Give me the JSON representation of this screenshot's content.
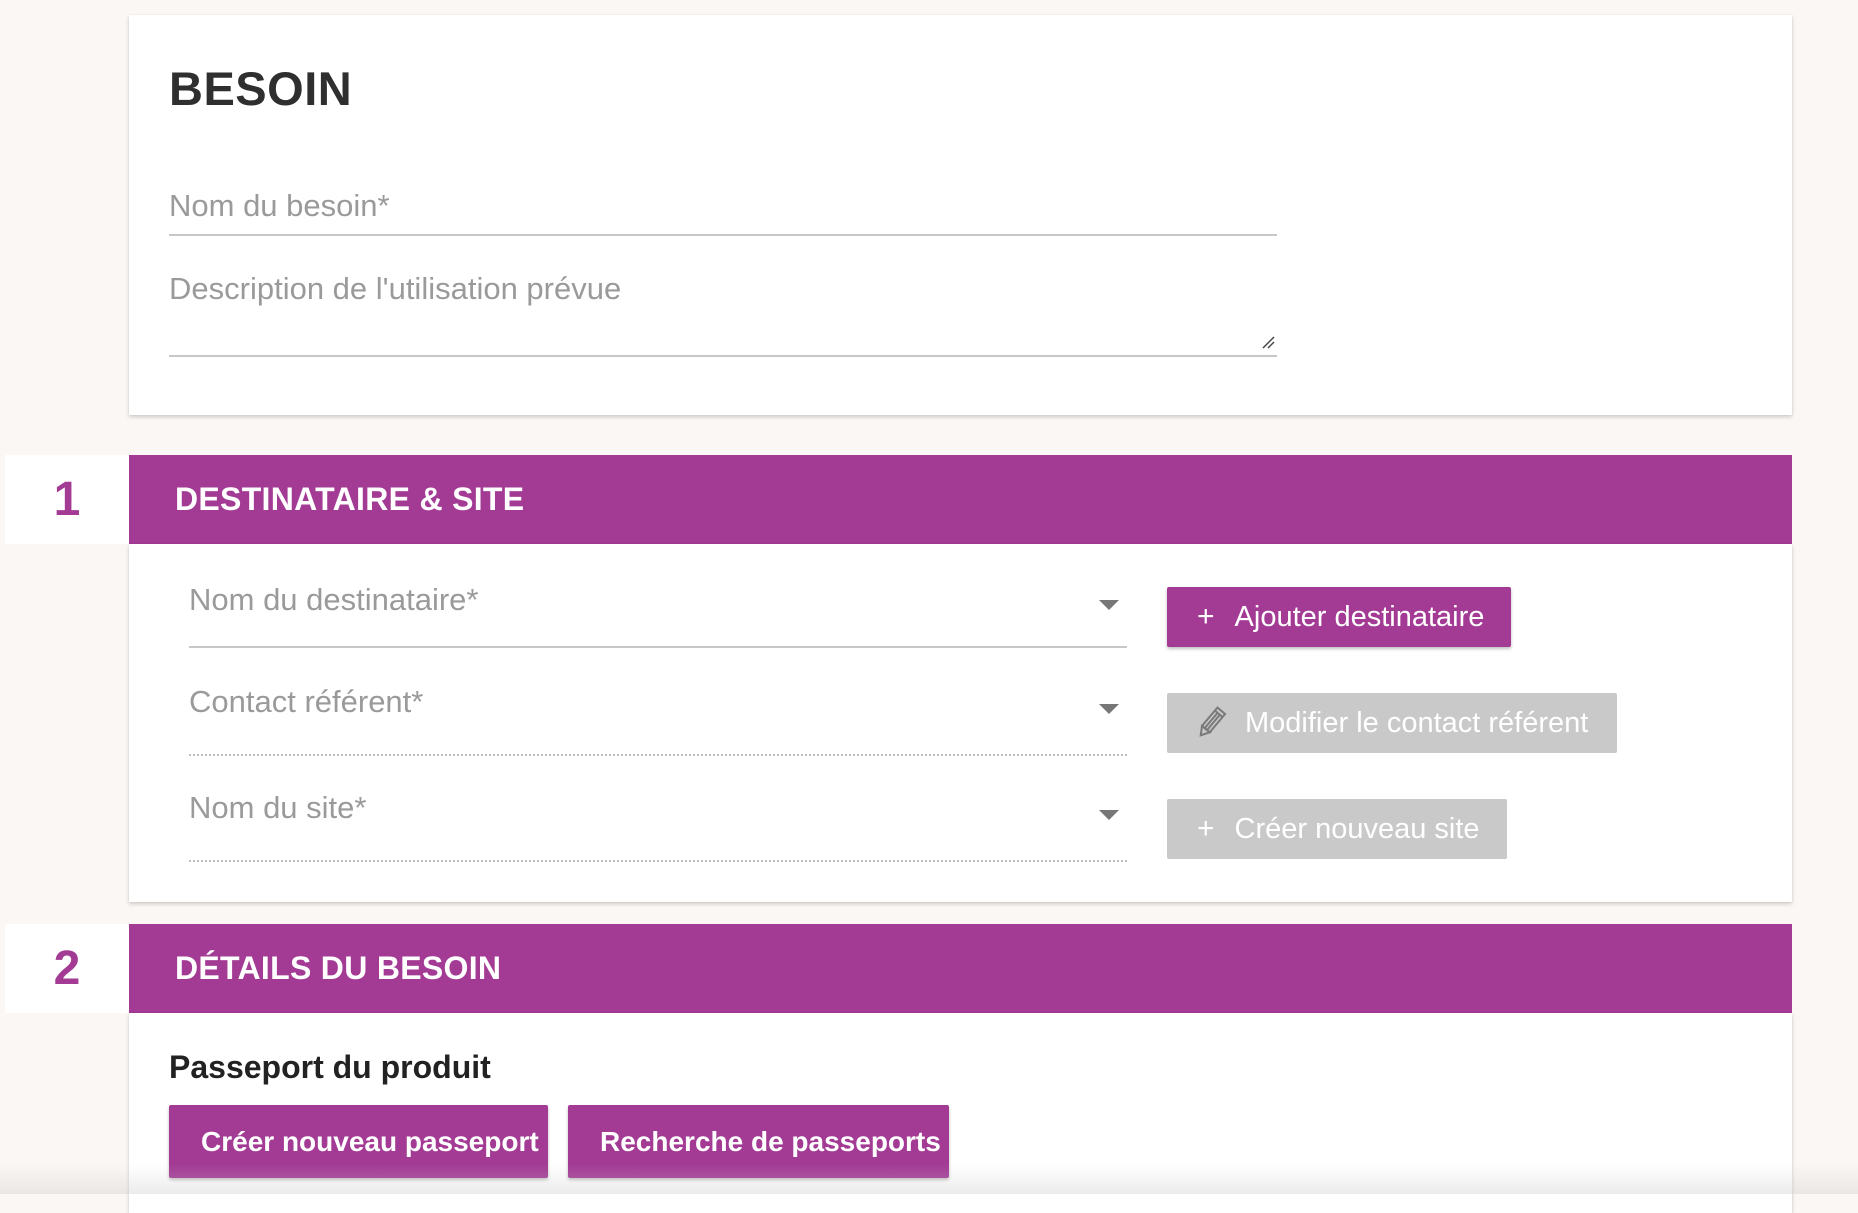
{
  "besoin": {
    "title": "BESOIN",
    "nom_placeholder": "Nom du besoin*",
    "description_placeholder": "Description de l'utilisation prévue"
  },
  "section1": {
    "number": "1",
    "title": "DESTINATAIRE & SITE",
    "destinataire_placeholder": "Nom du destinataire*",
    "contact_placeholder": "Contact référent*",
    "site_placeholder": "Nom du site*",
    "ajouter_label": "Ajouter destinataire",
    "modifier_label": "Modifier le contact référent",
    "creer_site_label": "Créer nouveau site",
    "plus_glyph": "+"
  },
  "section2": {
    "number": "2",
    "title": "DÉTAILS DU BESOIN",
    "passeport_heading": "Passeport du produit",
    "creer_passeport_label": "Créer nouveau passeport",
    "recherche_label": "Recherche de passeports"
  },
  "icons": {
    "plus": "plus-icon",
    "pencil": "pencil-icon",
    "dropdown": "chevron-down-icon",
    "resize": "resize-handle-icon"
  },
  "colors": {
    "accent": "#a33b95",
    "disabled": "#c9c9c9",
    "background": "#fbf7f4"
  }
}
